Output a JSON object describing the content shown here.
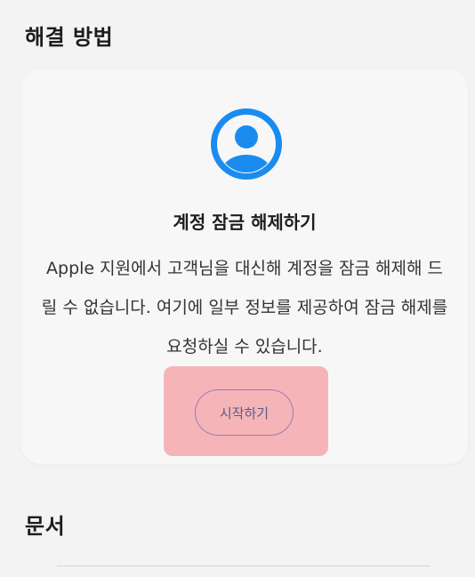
{
  "solutions_section": {
    "title": "해결 방법"
  },
  "card": {
    "icon": "user-circle-icon",
    "icon_color": "#1a8cf0",
    "title": "계정 잠금 해제하기",
    "description": "Apple 지원에서 고객님을 대신해 계정을 잠금 해제해 드릴 수 없습니다. 여기에 일부 정보를 제공하여 잠금 해제를 요청하실 수 있습니다.",
    "start_button_label": "시작하기",
    "highlight_color": "#f5b5b8"
  },
  "documents_section": {
    "title": "문서"
  }
}
